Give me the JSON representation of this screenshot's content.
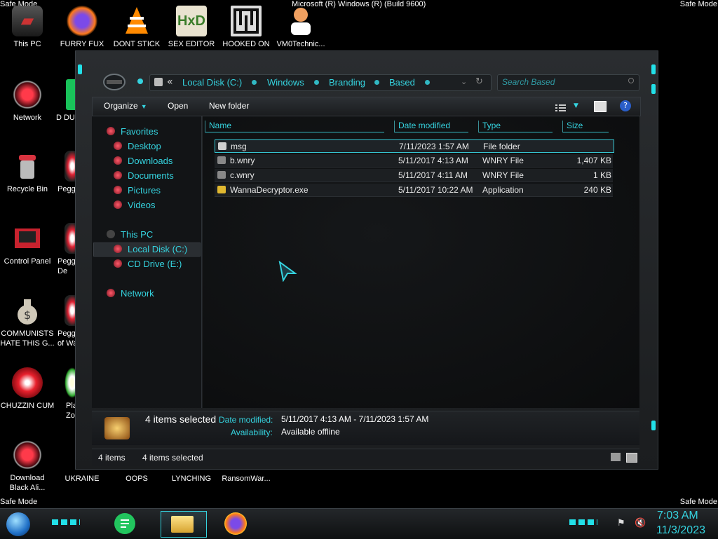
{
  "corners": {
    "top_left": "Safe Mode",
    "top_right": "Safe Mode",
    "bottom_left": "Safe Mode",
    "bottom_right": "Safe Mode"
  },
  "build_text": "Microsoft (R) Windows (R) (Build 9600)",
  "desktop": {
    "icons_top": [
      {
        "label": "This PC",
        "icon": "this-pc-icon"
      },
      {
        "label": "FURRY FUX",
        "icon": "firefox-icon"
      },
      {
        "label": "DONT STICK",
        "icon": "vlc-cone-icon"
      },
      {
        "label": "SEX EDITOR",
        "icon": "hxd-editor-icon"
      },
      {
        "label": "HOOKED ON",
        "icon": "maze-game-icon"
      },
      {
        "label": "VM0Technic...",
        "icon": "doctor-icon"
      }
    ],
    "icons_left": [
      {
        "label": "Network",
        "icon": "network-icon"
      },
      {
        "label": "Recycle Bin",
        "icon": "recycle-bin-icon"
      },
      {
        "label": "Control Panel",
        "icon": "control-panel-icon"
      },
      {
        "label": "COMMUNISTS HATE THIS G...",
        "icon": "money-bag-icon"
      },
      {
        "label": "CHUZZIN CUM",
        "icon": "chuzzle-icon"
      },
      {
        "label": "Download Black Ali...",
        "icon": "red-orb-icon"
      }
    ],
    "icons_col2_partial": [
      {
        "label": "D DUM",
        "icon": "green-file-icon"
      },
      {
        "label": "Peggl",
        "icon": "peggle-icon"
      },
      {
        "label": "Peggle De",
        "icon": "peggle-icon"
      },
      {
        "label": "Peggle of Wa",
        "icon": "peggle-icon"
      },
      {
        "label": "Plar Zo",
        "icon": "plants-icon"
      }
    ],
    "icons_bottom": [
      {
        "label": "UKRAINE",
        "icon": "peggle-icon"
      },
      {
        "label": "OOPS",
        "icon": "file-icon"
      },
      {
        "label": "LYNCHING",
        "icon": "file-icon"
      },
      {
        "label": "RansomWar...",
        "icon": "file-icon"
      }
    ]
  },
  "explorer": {
    "breadcrumb": [
      "Local Disk (C:)",
      "Windows",
      "Branding",
      "Based"
    ],
    "breadcrumb_prefix": "«",
    "search_placeholder": "Search Based",
    "toolbar": {
      "organize": "Organize",
      "open": "Open",
      "new_folder": "New folder"
    },
    "nav": {
      "favorites": "Favorites",
      "fav_items": [
        "Desktop",
        "Downloads",
        "Documents",
        "Pictures",
        "Videos"
      ],
      "this_pc": "This PC",
      "pc_items": [
        "Local Disk (C:)",
        "CD Drive (E:)"
      ],
      "network": "Network"
    },
    "columns": {
      "name": "Name",
      "date": "Date modified",
      "type": "Type",
      "size": "Size"
    },
    "files": [
      {
        "name": "msg",
        "date": "7/11/2023 1:57 AM",
        "type": "File folder",
        "size": ""
      },
      {
        "name": "b.wnry",
        "date": "5/11/2017 4:13 AM",
        "type": "WNRY File",
        "size": "1,407 KB"
      },
      {
        "name": "c.wnry",
        "date": "5/11/2017 4:11 AM",
        "type": "WNRY File",
        "size": "1 KB"
      },
      {
        "name": "WannaDecryptor.exe",
        "date": "5/11/2017 10:22 AM",
        "type": "Application",
        "size": "240 KB"
      }
    ],
    "details": {
      "selected": "4 items selected",
      "date_label": "Date modified:",
      "date_value": "5/11/2017 4:13 AM - 7/11/2023 1:57 AM",
      "avail_label": "Availability:",
      "avail_value": "Available offline"
    },
    "status": {
      "count": "4 items",
      "selected": "4 items selected"
    }
  },
  "taskbar": {
    "time": "7:03 AM",
    "date": "11/3/2023"
  },
  "colors": {
    "accent": "#35d3df",
    "background": "#000000"
  }
}
